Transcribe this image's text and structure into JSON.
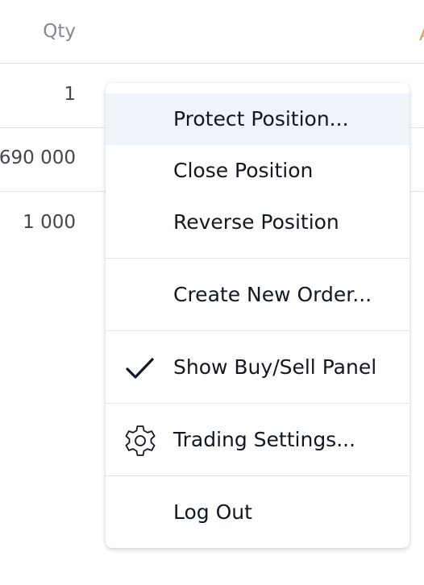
{
  "table": {
    "header": {
      "qty_label": "Qty",
      "next_col_partial": "A"
    },
    "rows": [
      {
        "qty": "1"
      },
      {
        "qty": "690 000"
      },
      {
        "qty": "1 000"
      }
    ]
  },
  "context_menu": {
    "items": [
      {
        "label": "Protect Position...",
        "highlighted": true
      },
      {
        "label": "Close Position"
      },
      {
        "label": "Reverse Position"
      },
      {
        "label": "Create New Order..."
      },
      {
        "label": "Show Buy/Sell Panel",
        "icon": "checkmark-icon",
        "checked": true
      },
      {
        "label": "Trading Settings...",
        "icon": "gear-icon"
      },
      {
        "label": "Log Out"
      }
    ]
  },
  "colors": {
    "highlight_bg": "#f0f3fa",
    "text_primary": "#131722",
    "text_secondary": "#868993",
    "accent": "#d1a15a",
    "divider": "#e0e3eb"
  }
}
